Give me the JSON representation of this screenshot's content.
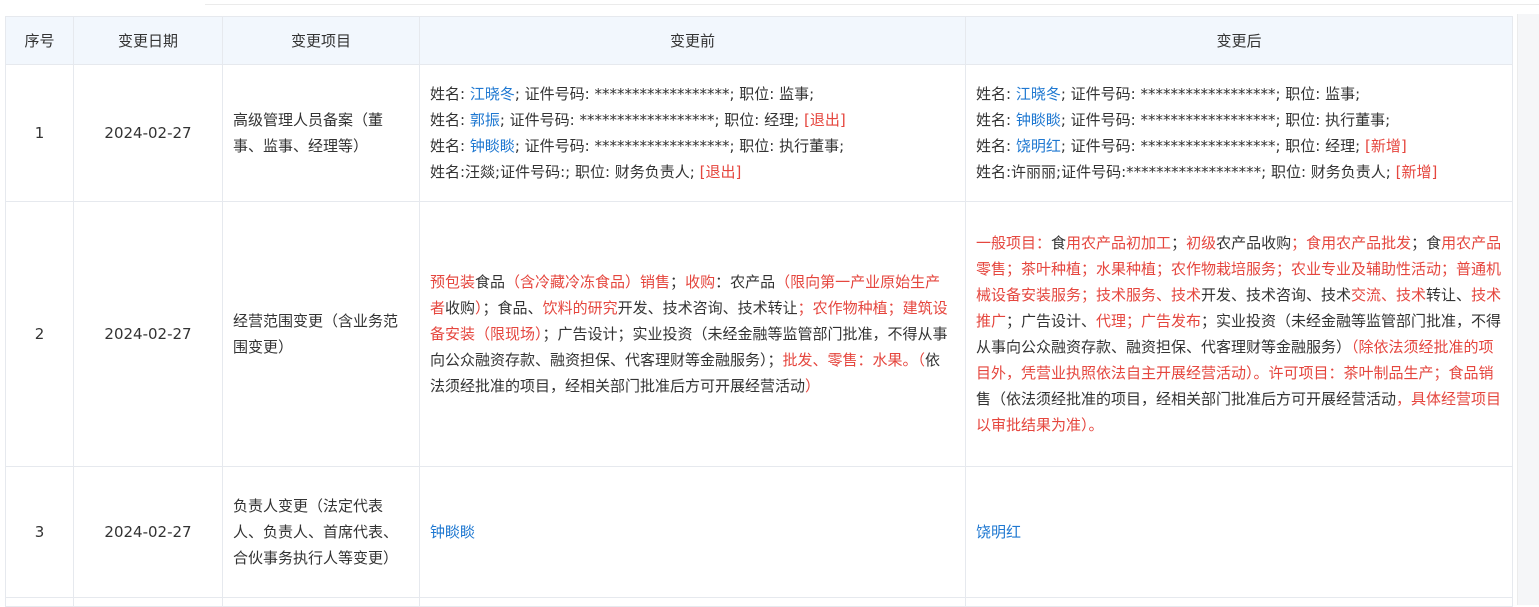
{
  "headers": [
    "序号",
    "变更日期",
    "变更项目",
    "变更前",
    "变更后"
  ],
  "rows": [
    {
      "no": "1",
      "date": "2024-02-27",
      "item": "高级管理人员备案（董事、监事、经理等）",
      "before": [
        [
          {
            "t": "姓名: "
          },
          {
            "t": "江晓冬",
            "c": "blue"
          },
          {
            "t": "; 证件号码: ******************; 职位: 监事;"
          }
        ],
        [
          {
            "t": "姓名: "
          },
          {
            "t": "郭振",
            "c": "blue"
          },
          {
            "t": "; 证件号码: ******************; 职位: 经理; "
          },
          {
            "t": "[退出]",
            "c": "red"
          }
        ],
        [
          {
            "t": "姓名: "
          },
          {
            "t": "钟睒睒",
            "c": "blue"
          },
          {
            "t": "; 证件号码: ******************; 职位: 执行董事;"
          }
        ],
        [
          {
            "t": "姓名:汪燚;证件号码:; 职位: 财务负责人; "
          },
          {
            "t": "[退出]",
            "c": "red"
          }
        ]
      ],
      "after": [
        [
          {
            "t": "姓名: "
          },
          {
            "t": "江晓冬",
            "c": "blue"
          },
          {
            "t": "; 证件号码: ******************; 职位: 监事;"
          }
        ],
        [
          {
            "t": "姓名: "
          },
          {
            "t": "钟睒睒",
            "c": "blue"
          },
          {
            "t": "; 证件号码: ******************; 职位: 执行董事;"
          }
        ],
        [
          {
            "t": "姓名: "
          },
          {
            "t": "饶明红",
            "c": "blue"
          },
          {
            "t": "; 证件号码: ******************; 职位: 经理; "
          },
          {
            "t": "[新增]",
            "c": "red"
          }
        ],
        [
          {
            "t": "姓名:许丽丽;证件号码:******************; 职位: 财务负责人; "
          },
          {
            "t": "[新增]",
            "c": "red"
          }
        ]
      ]
    },
    {
      "no": "2",
      "date": "2024-02-27",
      "item": "经营范围变更（含业务范围变更）",
      "before": [
        {
          "t": "预包装",
          "c": "red"
        },
        {
          "t": "食品"
        },
        {
          "t": "（含冷藏冷冻食品）销售",
          "c": "red"
        },
        {
          "t": "；"
        },
        {
          "t": "收购",
          "c": "red"
        },
        {
          "t": "：农产品"
        },
        {
          "t": "（限向第一产业原始生产者",
          "c": "red"
        },
        {
          "t": "收购"
        },
        {
          "t": "）",
          "c": "red"
        },
        {
          "t": "；食品、"
        },
        {
          "t": "饮料的研究",
          "c": "red"
        },
        {
          "t": "开发、技术咨询、技术转让"
        },
        {
          "t": "；农作物种植；建筑设备安装（限现场）",
          "c": "red"
        },
        {
          "t": "；广告设计；实业投资（未经金融等监管部门批准，不得从事向公众融资存款、融资担保、代客理财等金融服务）；"
        },
        {
          "t": "批发、零售：水果。（",
          "c": "red"
        },
        {
          "t": "依法须经批准的项目，经相关部门批准后方可开展经营活动"
        },
        {
          "t": "）",
          "c": "red"
        }
      ],
      "after": [
        {
          "t": "一般项目：",
          "c": "red"
        },
        {
          "t": "食"
        },
        {
          "t": "用农产品",
          "c": "red"
        },
        {
          "t": "初加工",
          "c": "red"
        },
        {
          "t": "；"
        },
        {
          "t": "初级",
          "c": "red"
        },
        {
          "t": "农产品收购"
        },
        {
          "t": "；食用农产品批发",
          "c": "red"
        },
        {
          "t": "；食"
        },
        {
          "t": "用农产品",
          "c": "red"
        },
        {
          "t": "零售",
          "c": "red"
        },
        {
          "t": "；茶叶种植；水果种植；农作物栽培服务；农业专业及辅助性活动；普通机械设备安装服务；技术服务、技术",
          "c": "red"
        },
        {
          "t": "开发、技术咨询、技术"
        },
        {
          "t": "交流、技术",
          "c": "red"
        },
        {
          "t": "转让、"
        },
        {
          "t": "技术推广",
          "c": "red"
        },
        {
          "t": "；广告设计、"
        },
        {
          "t": "代理；广告发布",
          "c": "red"
        },
        {
          "t": "；实业投资（未经金融等监管部门批准，不得从事向公众融资存款、融资担保、代客理财等金融服务）"
        },
        {
          "t": "（除依法须经批准的项目外，凭营业执照依法自主开展经营活动）。许可项目：茶叶制品生产；食品销",
          "c": "red"
        },
        {
          "t": "售（"
        },
        {
          "t": "依法须经批准的项目，经相关部门批准后方可开展经营活动"
        },
        {
          "t": "，具体经营项目以审批结果为准）。",
          "c": "red"
        }
      ]
    },
    {
      "no": "3",
      "date": "2024-02-27",
      "item": "负责人变更（法定代表人、负责人、首席代表、合伙事务执行人等变更）",
      "before_name": "钟睒睒",
      "after_name": "饶明红"
    }
  ]
}
